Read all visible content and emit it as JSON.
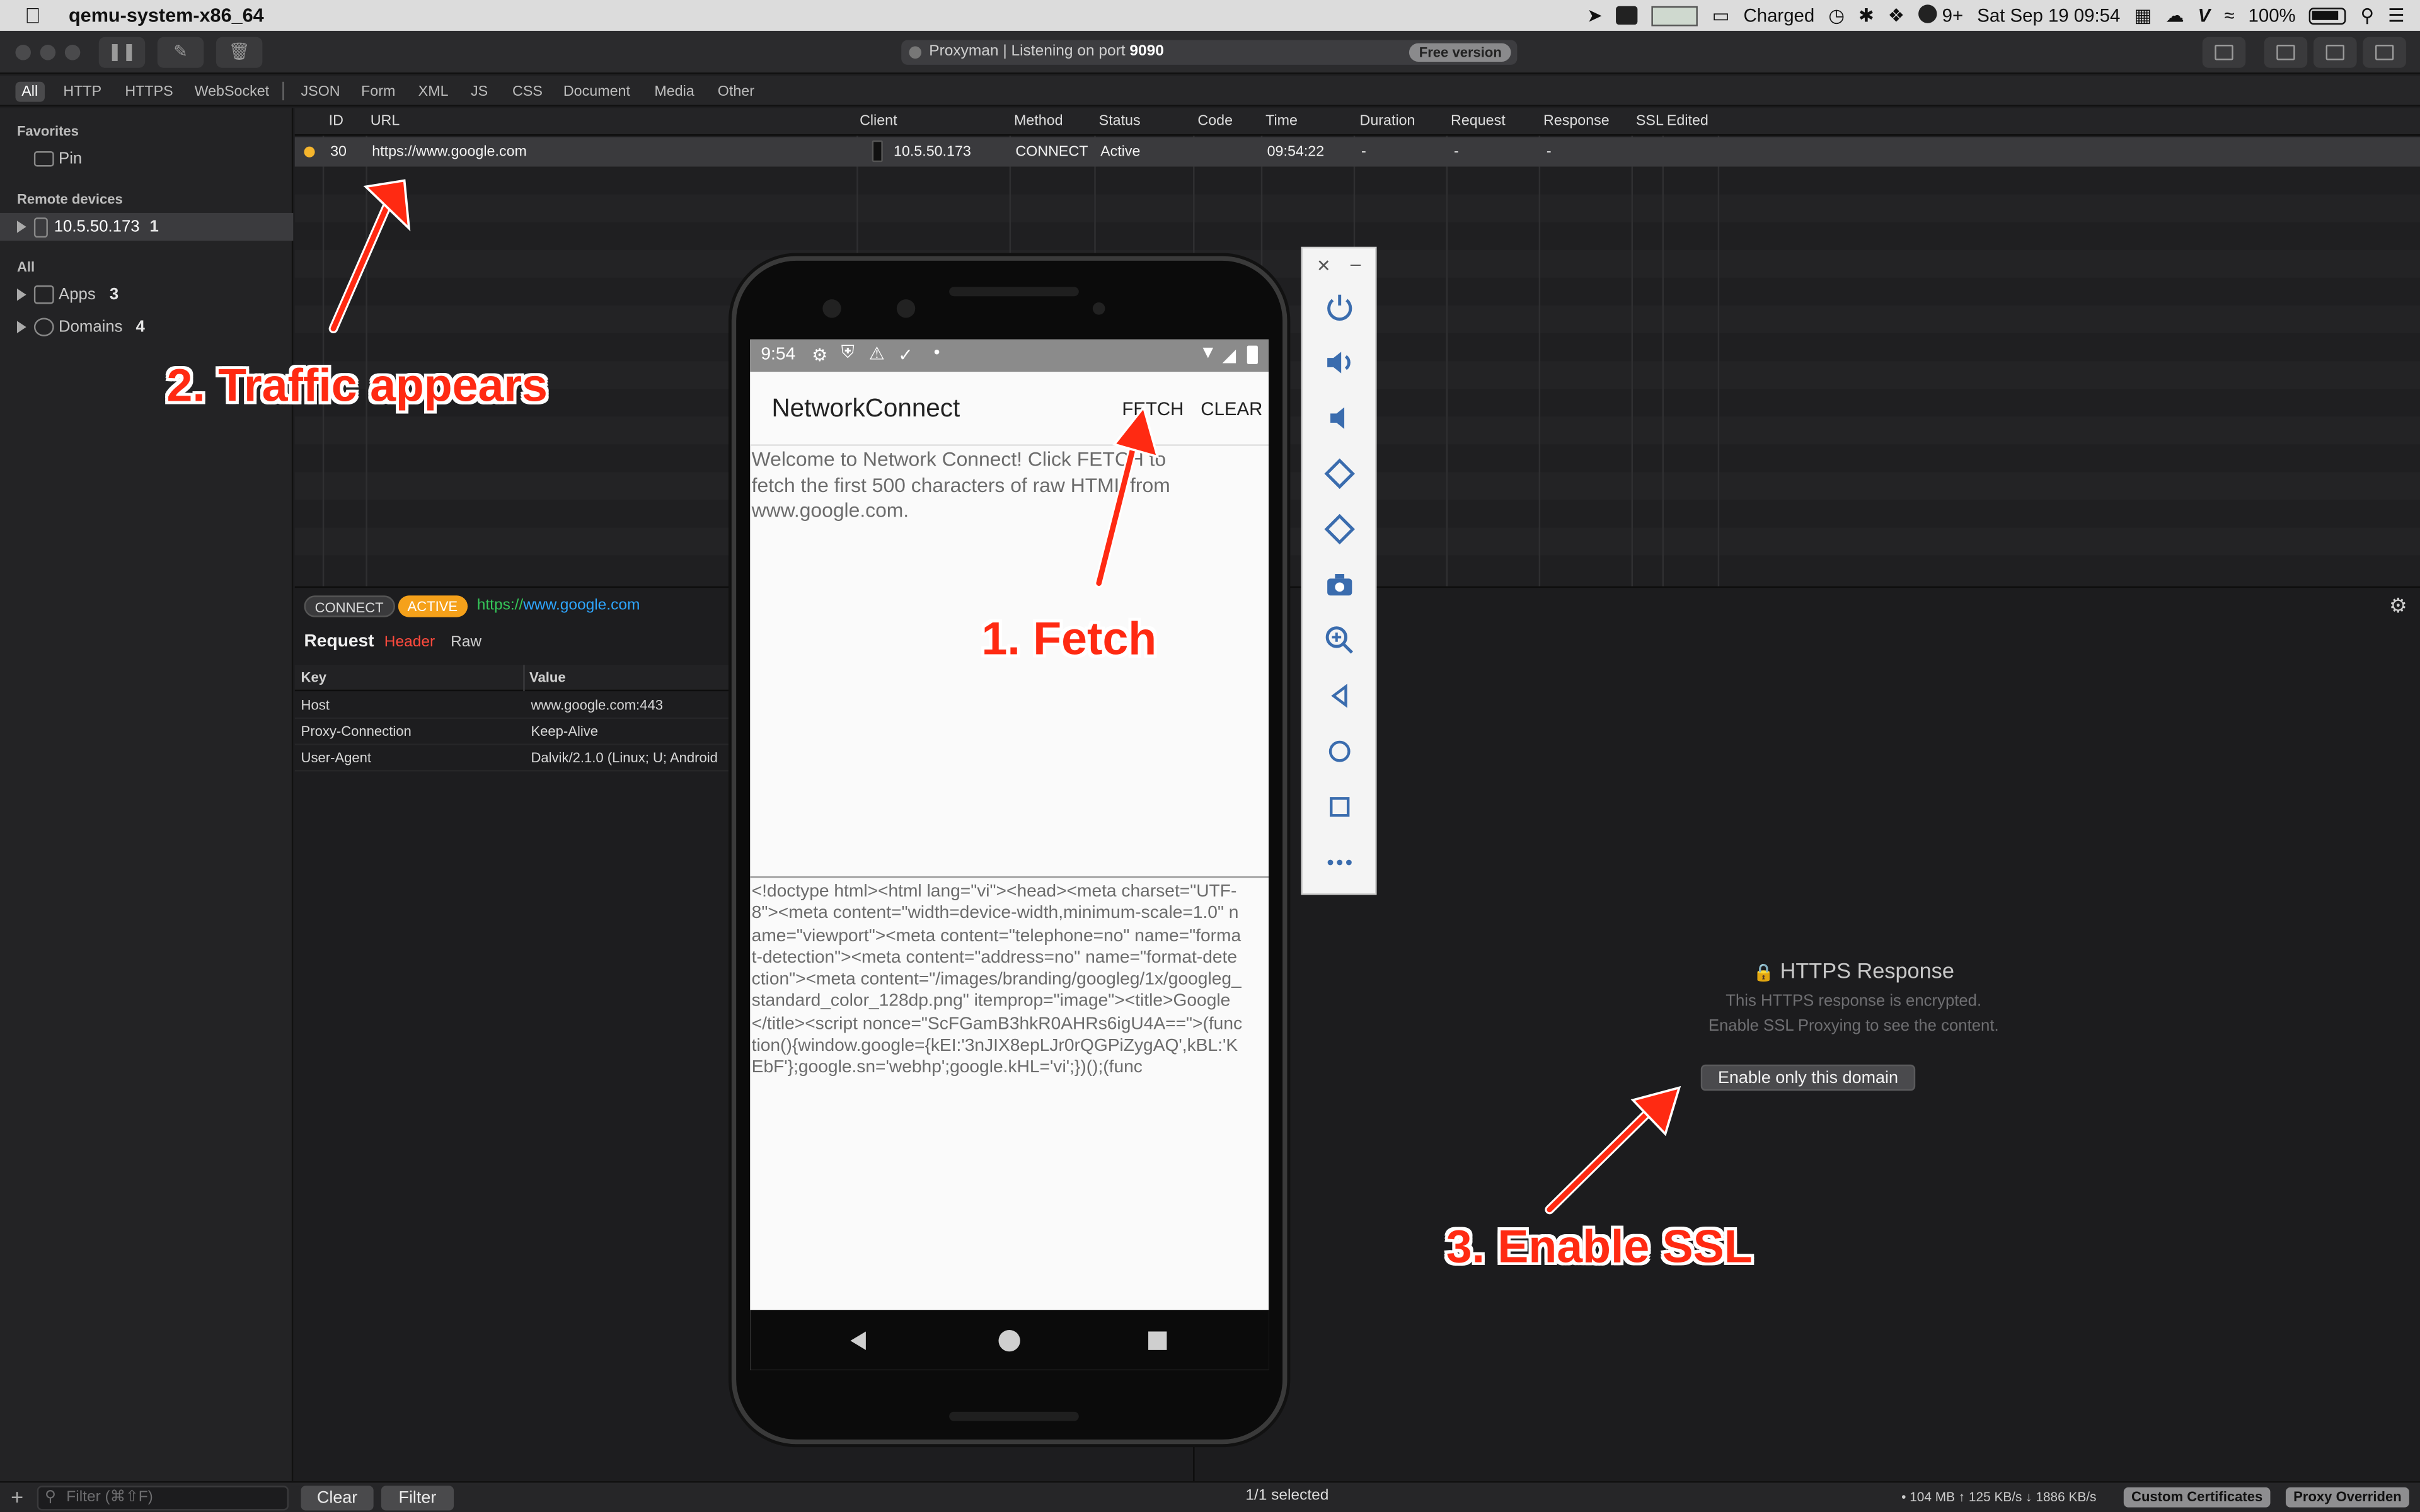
{
  "menubar": {
    "app_name": "qemu-system-x86_64",
    "battery_status": "Charged",
    "extras_count": "9+",
    "datetime": "Sat Sep 19  09:54",
    "battery_percent": "100%"
  },
  "toolbar": {
    "status_text": "Proxyman | Listening on port",
    "port": "9090",
    "free_badge": "Free version"
  },
  "filter_tabs": [
    "All",
    "HTTP",
    "HTTPS",
    "WebSocket",
    "JSON",
    "Form",
    "XML",
    "JS",
    "CSS",
    "Document",
    "Media",
    "Other"
  ],
  "sidebar": {
    "favorites_header": "Favorites",
    "pin_label": "Pin",
    "remote_header": "Remote devices",
    "device_label": "10.5.50.173",
    "device_count": "1",
    "all_header": "All",
    "apps_label": "Apps",
    "apps_count": "3",
    "domains_label": "Domains",
    "domains_count": "4"
  },
  "table": {
    "columns": [
      "ID",
      "URL",
      "Client",
      "Method",
      "Status",
      "Code",
      "Time",
      "Duration",
      "Request",
      "Response",
      "SSL",
      "Edited"
    ],
    "rows": [
      {
        "id": "30",
        "url": "https://www.google.com",
        "client": "10.5.50.173",
        "method": "CONNECT",
        "status": "Active",
        "code": "",
        "time": "09:54:22",
        "duration": "-",
        "request": "-",
        "response": "-",
        "ssl": "",
        "edited": ""
      }
    ],
    "status_dot_color": "#f5b52d"
  },
  "request_panel": {
    "method_badge": "CONNECT",
    "status_badge": "ACTIVE",
    "url_prefix": "https://",
    "url_host": "www.google.com",
    "tabs": {
      "title": "Request",
      "header": "Header",
      "raw": "Raw"
    },
    "kv_headers": {
      "key": "Key",
      "value": "Value"
    },
    "headers": [
      {
        "key": "Host",
        "value": "www.google.com:443"
      },
      {
        "key": "Proxy-Connection",
        "value": "Keep-Alive"
      },
      {
        "key": "User-Agent",
        "value": "Dalvik/2.1.0 (Linux; U; Android"
      }
    ]
  },
  "response_panel": {
    "title": "HTTPS Response",
    "line1": "This HTTPS response is encrypted.",
    "line2": "Enable SSL Proxying to see the content.",
    "button": "Enable only this domain"
  },
  "bottombar": {
    "filter_placeholder": "Filter (⌘⇧F)",
    "clear_label": "Clear",
    "filter_label": "Filter",
    "selection_text": "1/1 selected",
    "memory_text": "• 104 MB ↑ 125 KB/s ↓ 1886 KB/s",
    "certs_badge": "Custom Certificates",
    "proxy_badge": "Proxy Overriden"
  },
  "phone": {
    "clock": "9:54",
    "app_title": "NetworkConnect",
    "fetch_label": "FETCH",
    "clear_label": "CLEAR",
    "intro_text": "Welcome to Network Connect! Click FETCH to fetch the first 500 characters of raw HTML from www.google.com.",
    "html_output": "<!doctype html><html lang=\"vi\"><head><meta charset=\"UTF-8\"><meta content=\"width=device-width,minimum-scale=1.0\" name=\"viewport\"><meta content=\"telephone=no\" name=\"format-detection\"><meta content=\"address=no\" name=\"format-detection\"><meta content=\"/images/branding/googleg/1x/googleg_standard_color_128dp.png\" itemprop=\"image\"><title>Google</title><script nonce=\"ScFGamB3hkR0AHRs6igU4A==\">(function(){window.google={kEI:'3nJIX8epLJr0rQGPiZygAQ',kBL:'KEbF'};google.sn='webhp';google.kHL='vi';})();(func"
  },
  "annotations": {
    "step1": "1. Fetch",
    "step2": "2. Traffic appears",
    "step3": "3. Enable SSL"
  },
  "colors": {
    "accent_orange": "#f5a11a",
    "annotation_red": "#ff2a12",
    "header_tab_red": "#ff4a3d",
    "url_green": "#35c759",
    "url_blue": "#2ea6ff"
  }
}
